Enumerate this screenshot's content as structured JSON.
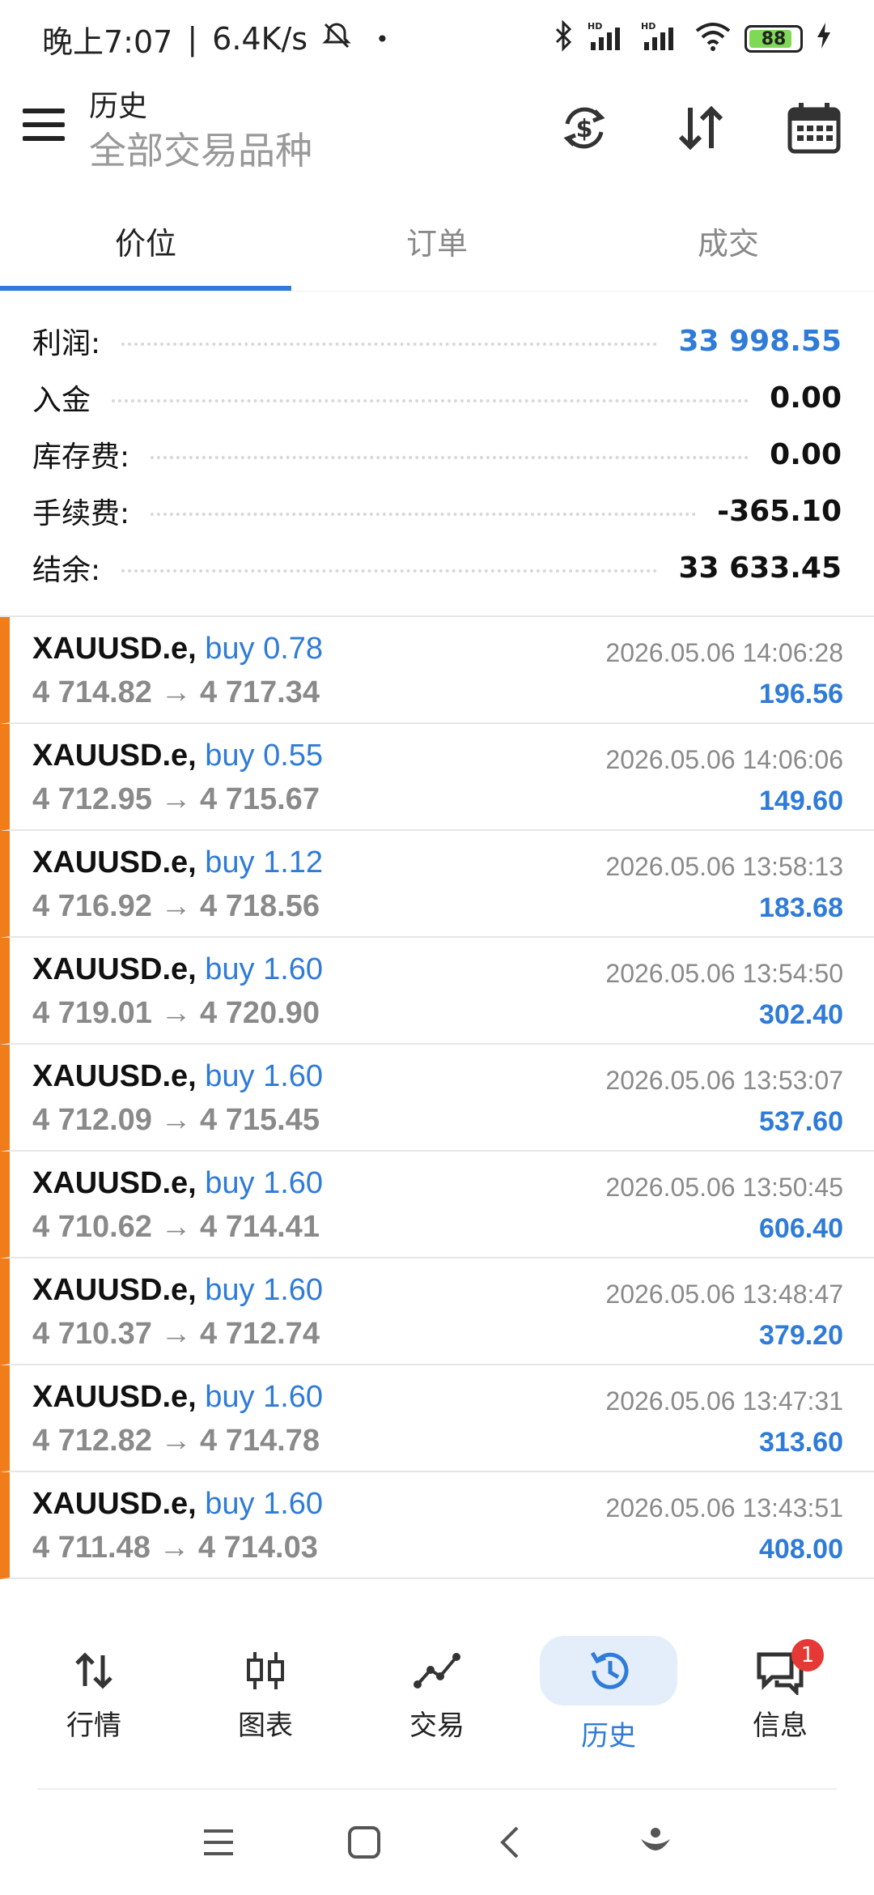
{
  "status_bar": {
    "time": "晚上7:07",
    "speed": "6.4K/s",
    "battery": "88"
  },
  "header": {
    "title": "历史",
    "subtitle": "全部交易品种"
  },
  "tabs": [
    {
      "label": "价位",
      "active": true
    },
    {
      "label": "订单",
      "active": false
    },
    {
      "label": "成交",
      "active": false
    }
  ],
  "summary": [
    {
      "label": "利润:",
      "value": "33 998.55",
      "highlight": true
    },
    {
      "label": "入金",
      "value": "0.00",
      "highlight": false
    },
    {
      "label": "库存费:",
      "value": "0.00",
      "highlight": false
    },
    {
      "label": "手续费:",
      "value": "-365.10",
      "highlight": false
    },
    {
      "label": "结余:",
      "value": "33 633.45",
      "highlight": false
    }
  ],
  "deals": [
    {
      "symbol": "XAUUSD.e,",
      "side": "buy 0.78",
      "prices": "4 714.82 → 4 717.34",
      "time": "2026.05.06 14:06:28",
      "profit": "196.56"
    },
    {
      "symbol": "XAUUSD.e,",
      "side": "buy 0.55",
      "prices": "4 712.95 → 4 715.67",
      "time": "2026.05.06 14:06:06",
      "profit": "149.60"
    },
    {
      "symbol": "XAUUSD.e,",
      "side": "buy 1.12",
      "prices": "4 716.92 → 4 718.56",
      "time": "2026.05.06 13:58:13",
      "profit": "183.68"
    },
    {
      "symbol": "XAUUSD.e,",
      "side": "buy 1.60",
      "prices": "4 719.01 → 4 720.90",
      "time": "2026.05.06 13:54:50",
      "profit": "302.40"
    },
    {
      "symbol": "XAUUSD.e,",
      "side": "buy 1.60",
      "prices": "4 712.09 → 4 715.45",
      "time": "2026.05.06 13:53:07",
      "profit": "537.60"
    },
    {
      "symbol": "XAUUSD.e,",
      "side": "buy 1.60",
      "prices": "4 710.62 → 4 714.41",
      "time": "2026.05.06 13:50:45",
      "profit": "606.40"
    },
    {
      "symbol": "XAUUSD.e,",
      "side": "buy 1.60",
      "prices": "4 710.37 → 4 712.74",
      "time": "2026.05.06 13:48:47",
      "profit": "379.20"
    },
    {
      "symbol": "XAUUSD.e,",
      "side": "buy 1.60",
      "prices": "4 712.82 → 4 714.78",
      "time": "2026.05.06 13:47:31",
      "profit": "313.60"
    },
    {
      "symbol": "XAUUSD.e,",
      "side": "buy 1.60",
      "prices": "4 711.48 → 4 714.03",
      "time": "2026.05.06 13:43:51",
      "profit": "408.00"
    }
  ],
  "bottom_nav": [
    {
      "label": "行情",
      "icon": "quotes-icon",
      "active": false
    },
    {
      "label": "图表",
      "icon": "chart-icon",
      "active": false
    },
    {
      "label": "交易",
      "icon": "trade-icon",
      "active": false
    },
    {
      "label": "历史",
      "icon": "history-icon",
      "active": true
    },
    {
      "label": "信息",
      "icon": "messages-icon",
      "active": false
    }
  ],
  "messages_badge": "1",
  "colors": {
    "accent": "#2f7bd8",
    "deal_marker": "#f07d1a",
    "badge": "#e53935"
  }
}
